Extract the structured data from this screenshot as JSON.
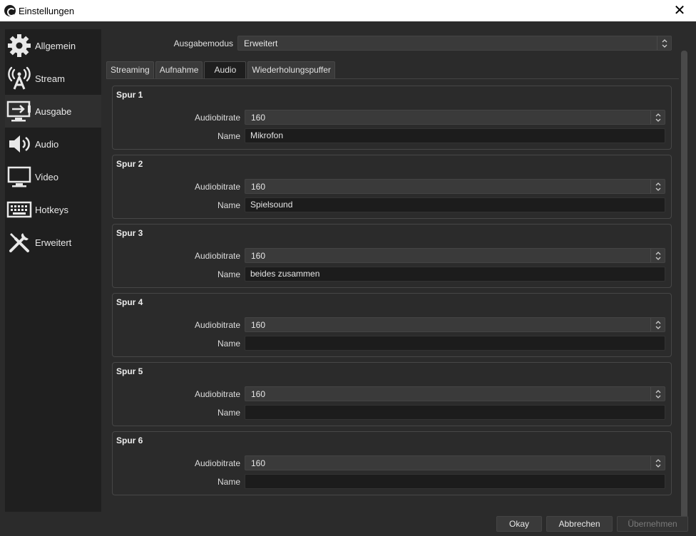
{
  "window": {
    "title": "Einstellungen"
  },
  "sidebar": {
    "items": [
      {
        "label": "Allgemein",
        "icon": "gear-icon"
      },
      {
        "label": "Stream",
        "icon": "antenna-icon"
      },
      {
        "label": "Ausgabe",
        "icon": "output-monitor-icon"
      },
      {
        "label": "Audio",
        "icon": "speaker-icon"
      },
      {
        "label": "Video",
        "icon": "monitor-icon"
      },
      {
        "label": "Hotkeys",
        "icon": "keyboard-icon"
      },
      {
        "label": "Erweitert",
        "icon": "tools-icon"
      }
    ],
    "active": "Ausgabe"
  },
  "output": {
    "mode_label": "Ausgabemodus",
    "mode_value": "Erweitert",
    "tabs": [
      "Streaming",
      "Aufnahme",
      "Audio",
      "Wiederholungspuffer"
    ],
    "active_tab": "Audio"
  },
  "tracks": [
    {
      "title": "Spur 1",
      "bitrate_label": "Audiobitrate",
      "bitrate": "160",
      "name_label": "Name",
      "name": "Mikrofon"
    },
    {
      "title": "Spur 2",
      "bitrate_label": "Audiobitrate",
      "bitrate": "160",
      "name_label": "Name",
      "name": "Spielsound"
    },
    {
      "title": "Spur 3",
      "bitrate_label": "Audiobitrate",
      "bitrate": "160",
      "name_label": "Name",
      "name": "beides zusammen"
    },
    {
      "title": "Spur 4",
      "bitrate_label": "Audiobitrate",
      "bitrate": "160",
      "name_label": "Name",
      "name": ""
    },
    {
      "title": "Spur 5",
      "bitrate_label": "Audiobitrate",
      "bitrate": "160",
      "name_label": "Name",
      "name": ""
    },
    {
      "title": "Spur 6",
      "bitrate_label": "Audiobitrate",
      "bitrate": "160",
      "name_label": "Name",
      "name": ""
    }
  ],
  "buttons": {
    "ok": "Okay",
    "cancel": "Abbrechen",
    "apply": "Übernehmen"
  }
}
